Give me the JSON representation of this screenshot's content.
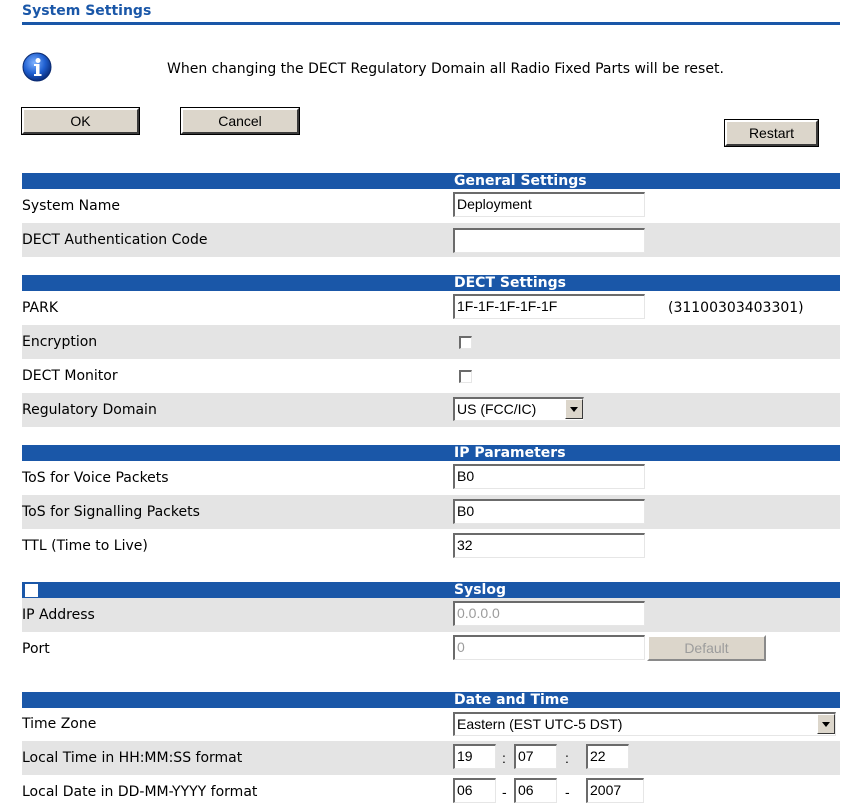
{
  "title": "System Settings",
  "info": {
    "icon": "info-icon",
    "message": "When changing the DECT Regulatory Domain all Radio Fixed Parts will be reset."
  },
  "buttons": {
    "ok": "OK",
    "cancel": "Cancel",
    "restart": "Restart"
  },
  "general": {
    "header": "General Settings",
    "system_name_label": "System Name",
    "system_name_value": "Deployment",
    "auth_code_label": "DECT Authentication Code",
    "auth_code_value": ""
  },
  "dect": {
    "header": "DECT Settings",
    "park_label": "PARK",
    "park_value": "1F-1F-1F-1F-1F",
    "park_code": "(31100303403301)",
    "encryption_label": "Encryption",
    "encryption_checked": false,
    "monitor_label": "DECT Monitor",
    "monitor_checked": false,
    "domain_label": "Regulatory Domain",
    "domain_value": "US (FCC/IC)"
  },
  "ip": {
    "header": "IP Parameters",
    "tos_voice_label": "ToS for Voice Packets",
    "tos_voice_value": "B0",
    "tos_signal_label": "ToS for Signalling Packets",
    "tos_signal_value": "B0",
    "ttl_label": "TTL (Time to Live)",
    "ttl_value": "32"
  },
  "syslog": {
    "header": "Syslog",
    "enabled": false,
    "ip_label": "IP Address",
    "ip_value": "0.0.0.0",
    "port_label": "Port",
    "port_value": "0",
    "default_button": "Default"
  },
  "datetime": {
    "header": "Date and Time",
    "tz_label": "Time Zone",
    "tz_value": "Eastern (EST UTC-5 DST)",
    "time_label": "Local Time in HH:MM:SS format",
    "hh": "19",
    "mm": "07",
    "ss": "22",
    "time_sep": ":",
    "date_label": "Local Date in DD-MM-YYYY format",
    "dd": "06",
    "mo": "06",
    "yyyy": "2007",
    "date_sep": "-"
  },
  "colors": {
    "accent": "#1a57a8",
    "row_alt": "#e4e4e4",
    "button_face": "#dcd6cb"
  }
}
